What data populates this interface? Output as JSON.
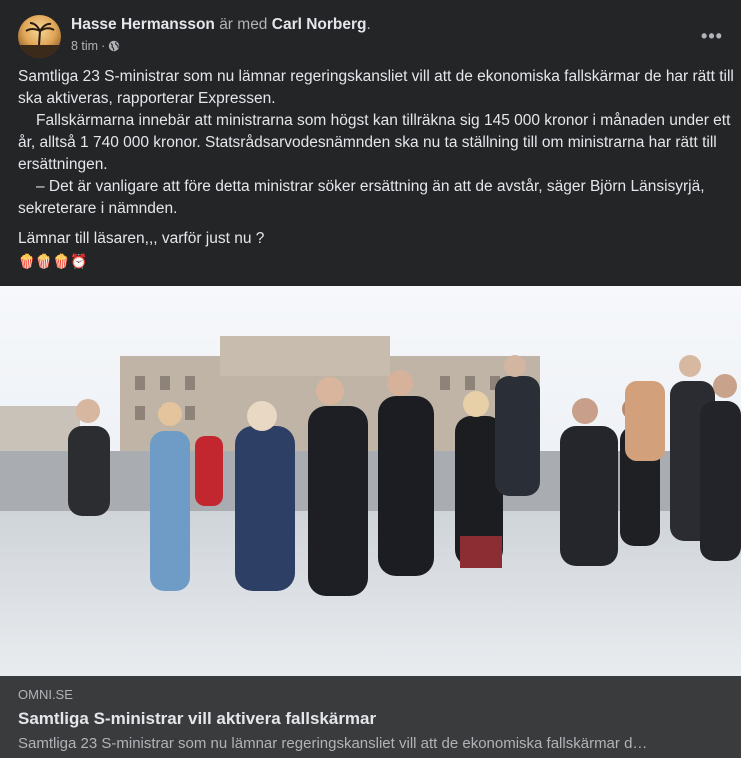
{
  "post": {
    "author": "Hasse Hermansson",
    "with_text": "är med",
    "tagged": "Carl Norberg",
    "tagged_suffix": ".",
    "time": "8 tim",
    "time_sep": "·",
    "privacy_icon": "globe-icon",
    "more_label": "•••",
    "paragraphs": [
      "Samtliga 23 S-ministrar som nu lämnar regeringskansliet vill att de ekonomiska fallskärmar de har rätt till ska aktiveras, rapporterar Expressen.",
      "Fallskärmarna innebär att ministrarna som högst kan tillräkna sig 145 000 kronor i månaden under ett år, alltså 1 740 000 kronor. Statsrådsarvodesnämnden ska nu ta ställning till om ministrarna har rätt till ersättningen.",
      "– Det är vanligare att före detta ministrar söker ersättning än att de avstår, säger Björn Länsisyrjä, sekreterare i nämnden.",
      "Lämnar till läsaren,,, varför just nu ?"
    ],
    "emojis": "🍿🍿🍿⏰"
  },
  "link": {
    "domain": "OMNI.SE",
    "title": "Samtliga S-ministrar vill aktivera fallskärmar",
    "description": "Samtliga 23 S-ministrar som nu lämnar regeringskansliet vill att de ekonomiska fallskärmar d…"
  },
  "colors": {
    "background": "#242526",
    "text": "#e4e6eb",
    "secondary_text": "#b0b3b8",
    "link_box": "#3a3b3c"
  }
}
